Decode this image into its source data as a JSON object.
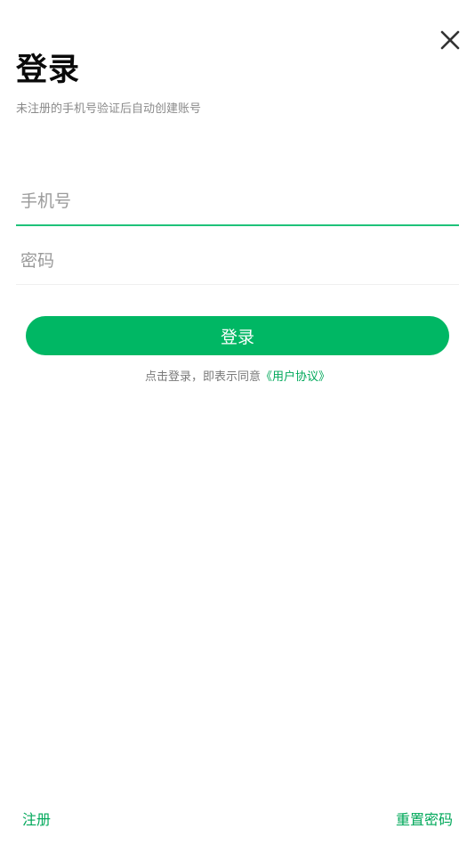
{
  "header": {
    "title": "登录",
    "subtitle": "未注册的手机号验证后自动创建账号",
    "close_icon": "close-icon"
  },
  "form": {
    "phone_placeholder": "手机号",
    "phone_value": "",
    "password_placeholder": "密码",
    "password_value": "",
    "login_label": "登录"
  },
  "agreement": {
    "prefix": "点击登录，即表示同意",
    "link": "《用户协议》"
  },
  "footer": {
    "register_label": "注册",
    "reset_password_label": "重置密码"
  },
  "colors": {
    "accent": "#00b764",
    "link": "#00a85a",
    "underline_active": "#1ec27a"
  }
}
